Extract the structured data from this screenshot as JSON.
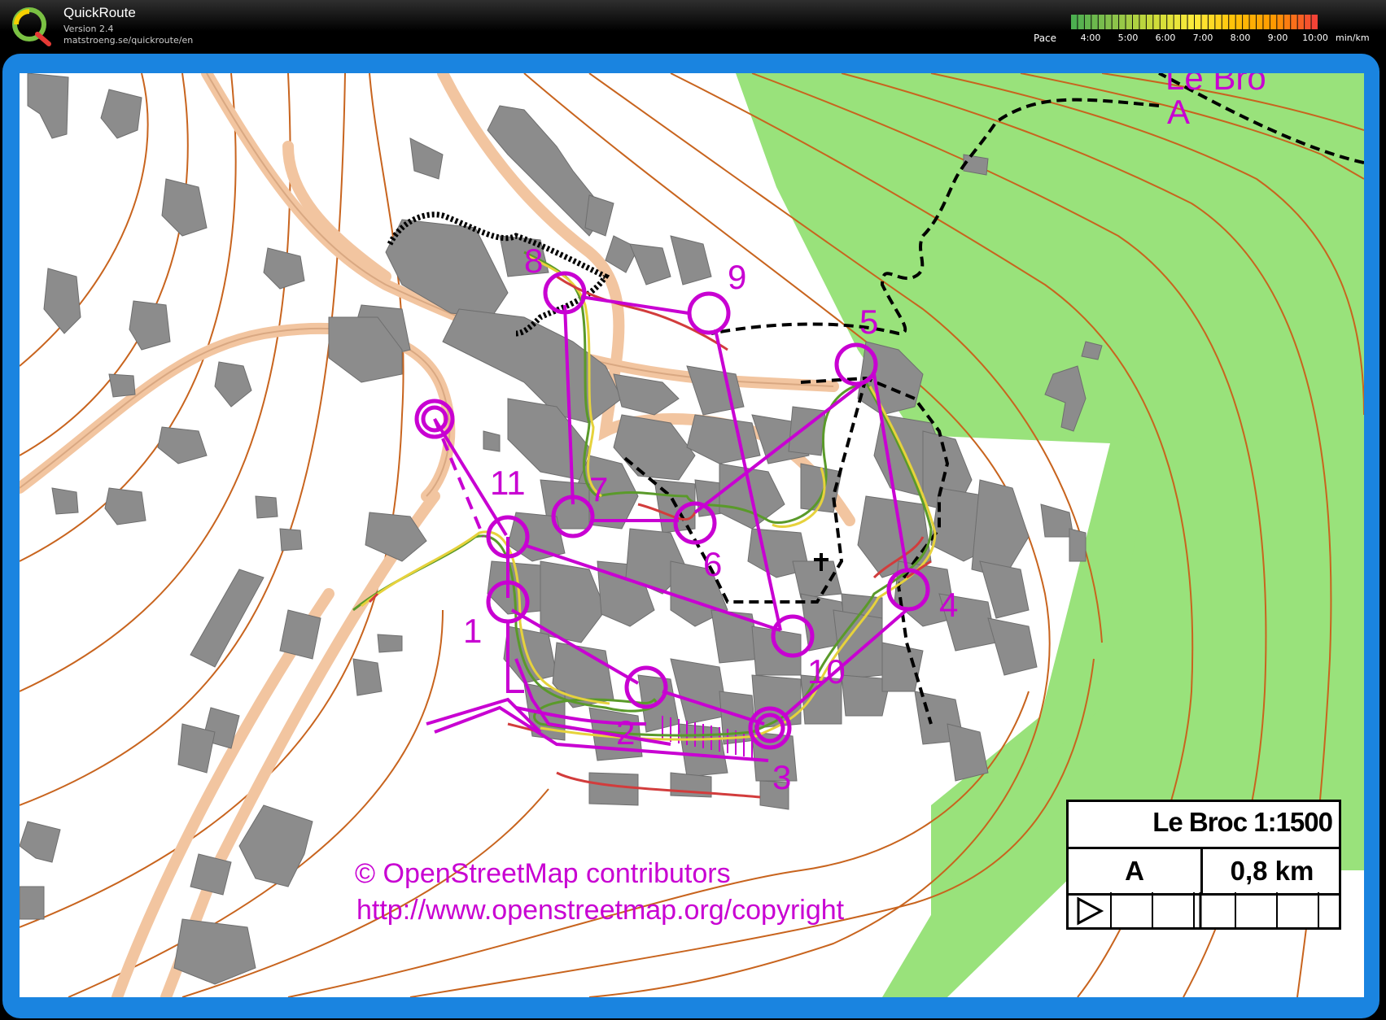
{
  "app": {
    "title": "QuickRoute",
    "version": "Version 2.4",
    "url": "matstroeng.se/quickroute/en"
  },
  "pace": {
    "label": "Pace",
    "ticks": [
      "4:00",
      "5:00",
      "6:00",
      "7:00",
      "8:00",
      "9:00",
      "10:00"
    ],
    "unit": "min/km",
    "colors": [
      "#4caf50",
      "#8bc34a",
      "#cddc39",
      "#ffeb3b",
      "#ffc107",
      "#ff9800",
      "#f44336"
    ]
  },
  "map": {
    "colors": {
      "building": "#8c8c8c",
      "contour": "#c8641e",
      "road": "#f5c8a0",
      "forest": "#99e27b",
      "course": "#c800d2",
      "route_green": "#5a9a2a",
      "route_yellow": "#e6d23c",
      "route_red": "#d23c3c",
      "boundary": "#000000"
    },
    "place_label": "Le Bro",
    "place_sub": "A",
    "controls": [
      "1",
      "2",
      "3",
      "4",
      "5",
      "6",
      "7",
      "8",
      "9",
      "10",
      "11"
    ],
    "credit_line1": "© OpenStreetMap contributors",
    "credit_line2": "http://www.openstreetmap.org/copyright"
  },
  "legend": {
    "title": "Le Broc 1:1500",
    "course": "A",
    "length": "0,8 km"
  }
}
